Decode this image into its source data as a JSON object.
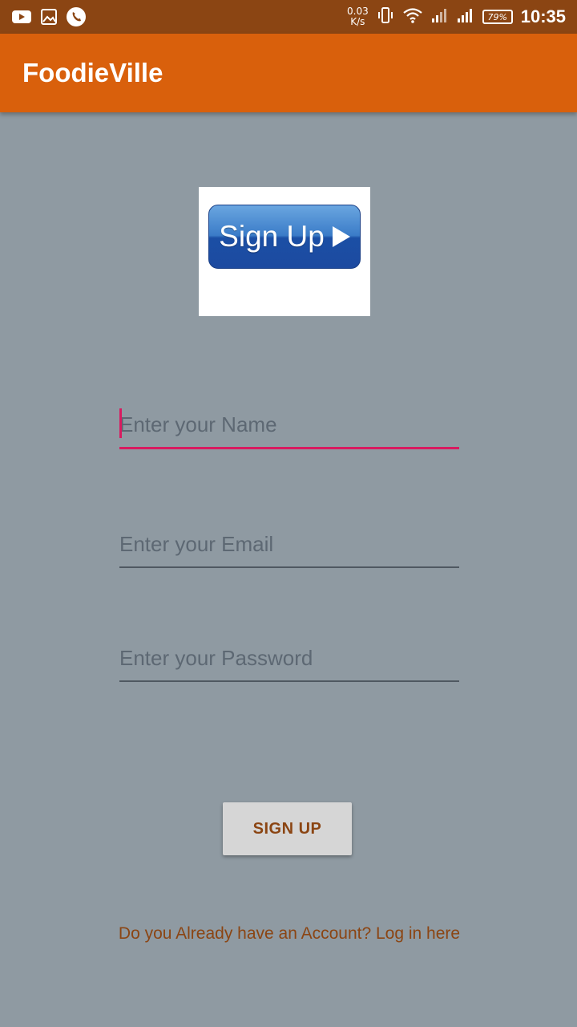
{
  "status_bar": {
    "net_speed_value": "0.03",
    "net_speed_unit": "K/s",
    "battery": "79%",
    "time": "10:35",
    "icons": [
      "youtube-icon",
      "image-icon",
      "phone-icon",
      "vibrate-icon",
      "wifi-icon",
      "signal-icon",
      "signal-icon"
    ]
  },
  "app_bar": {
    "title": "FoodieVille"
  },
  "logo": {
    "text": "Sign Up"
  },
  "form": {
    "name_placeholder": "Enter your Name",
    "email_placeholder": "Enter your Email",
    "password_placeholder": "Enter your Password",
    "submit_label": "SIGN UP"
  },
  "footer": {
    "login_link": "Do you Already have an Account? Log in here"
  },
  "colors": {
    "status_bar": "#8b4513",
    "app_bar": "#d9600c",
    "background": "#8f9aa2",
    "accent": "#d81b60",
    "link": "#8b4513"
  }
}
